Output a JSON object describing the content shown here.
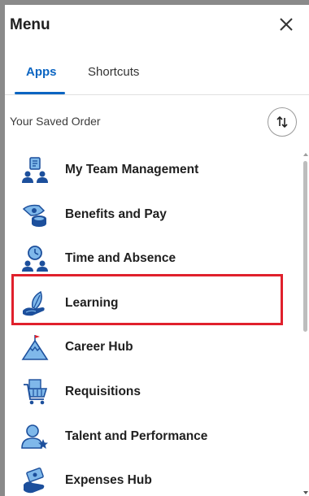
{
  "header": {
    "title": "Menu",
    "close_icon": "close-icon"
  },
  "tabs": [
    {
      "label": "Apps",
      "selected": true
    },
    {
      "label": "Shortcuts",
      "selected": false
    }
  ],
  "saved_order": {
    "label": "Your Saved Order",
    "sort_icon": "sort-arrows-icon"
  },
  "apps": [
    {
      "label": "My Team Management",
      "icon": "team-management-icon"
    },
    {
      "label": "Benefits and Pay",
      "icon": "benefits-pay-icon"
    },
    {
      "label": "Time and Absence",
      "icon": "time-absence-icon"
    },
    {
      "label": "Learning",
      "icon": "learning-icon",
      "highlighted": true
    },
    {
      "label": "Career Hub",
      "icon": "career-hub-icon"
    },
    {
      "label": "Requisitions",
      "icon": "requisitions-icon"
    },
    {
      "label": "Talent and Performance",
      "icon": "talent-performance-icon"
    },
    {
      "label": "Expenses Hub",
      "icon": "expenses-hub-icon"
    }
  ],
  "colors": {
    "accent": "#0b65c2",
    "highlight_border": "#e0202c",
    "icon_dark": "#1c4f9c",
    "icon_light": "#7fb8ea"
  }
}
